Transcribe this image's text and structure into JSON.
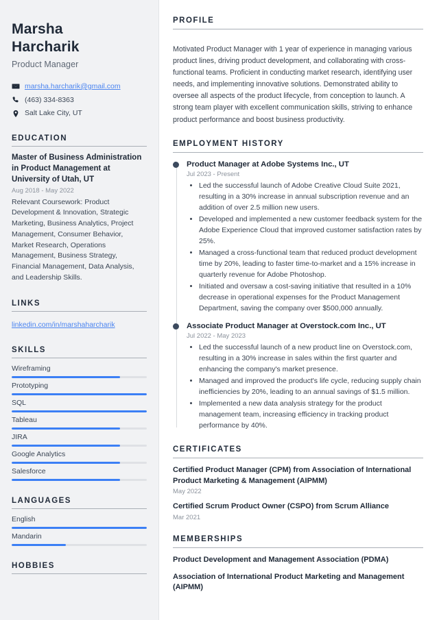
{
  "colors": {
    "accent": "#3b7ff5",
    "link": "#4a84f0",
    "heading": "#212b3a",
    "sidebar_bg": "#f1f2f4",
    "timeline_dot": "#3c4a5e"
  },
  "header": {
    "first_name": "Marsha",
    "last_name": "Harcharik",
    "job_title": "Product Manager",
    "contacts": [
      {
        "icon": "envelope-icon",
        "text": "marsha.harcharik@gmail.com",
        "is_link": true
      },
      {
        "icon": "phone-icon",
        "text": "(463) 334-8363",
        "is_link": false
      },
      {
        "icon": "location-pin-icon",
        "text": "Salt Lake City, UT",
        "is_link": false
      }
    ]
  },
  "sidebar": {
    "education": {
      "heading": "EDUCATION",
      "items": [
        {
          "title": "Master of Business Administration in Product Management at University of Utah, UT",
          "date": "Aug 2018 - May 2022",
          "description": "Relevant Coursework: Product Development & Innovation, Strategic Marketing, Business Analytics, Project Management, Consumer Behavior, Market Research, Operations Management, Business Strategy, Financial Management, Data Analysis, and Leadership Skills."
        }
      ]
    },
    "links": {
      "heading": "LINKS",
      "items": [
        {
          "label": "linkedin.com/in/marshaharcharik"
        }
      ]
    },
    "skills": {
      "heading": "SKILLS",
      "items": [
        {
          "label": "Wireframing",
          "level": 80
        },
        {
          "label": "Prototyping",
          "level": 100
        },
        {
          "label": "SQL",
          "level": 100
        },
        {
          "label": "Tableau",
          "level": 80
        },
        {
          "label": "JIRA",
          "level": 80
        },
        {
          "label": "Google Analytics",
          "level": 80
        },
        {
          "label": "Salesforce",
          "level": 80
        }
      ]
    },
    "languages": {
      "heading": "LANGUAGES",
      "items": [
        {
          "label": "English",
          "level": 100
        },
        {
          "label": "Mandarin",
          "level": 40
        }
      ]
    },
    "hobbies": {
      "heading": "HOBBIES"
    }
  },
  "main": {
    "profile": {
      "heading": "PROFILE",
      "text": "Motivated Product Manager with 1 year of experience in managing various product lines, driving product development, and collaborating with cross-functional teams. Proficient in conducting market research, identifying user needs, and implementing innovative solutions. Demonstrated ability to oversee all aspects of the product lifecycle, from conception to launch. A strong team player with excellent communication skills, striving to enhance product performance and boost business productivity."
    },
    "employment": {
      "heading": "EMPLOYMENT HISTORY",
      "jobs": [
        {
          "title": "Product Manager at Adobe Systems Inc., UT",
          "date": "Jul 2023 - Present",
          "bullets": [
            "Led the successful launch of Adobe Creative Cloud Suite 2021, resulting in a 30% increase in annual subscription revenue and an addition of over 2.5 million new users.",
            "Developed and implemented a new customer feedback system for the Adobe Experience Cloud that improved customer satisfaction rates by 25%.",
            "Managed a cross-functional team that reduced product development time by 20%, leading to faster time-to-market and a 15% increase in quarterly revenue for Adobe Photoshop.",
            "Initiated and oversaw a cost-saving initiative that resulted in a 10% decrease in operational expenses for the Product Management Department, saving the company over $500,000 annually."
          ]
        },
        {
          "title": "Associate Product Manager at Overstock.com Inc., UT",
          "date": "Jul 2022 - May 2023",
          "bullets": [
            "Led the successful launch of a new product line on Overstock.com, resulting in a 30% increase in sales within the first quarter and enhancing the company's market presence.",
            "Managed and improved the product's life cycle, reducing supply chain inefficiencies by 20%, leading to an annual savings of $1.5 million.",
            "Implemented a new data analysis strategy for the product management team, increasing efficiency in tracking product performance by 40%."
          ]
        }
      ]
    },
    "certificates": {
      "heading": "CERTIFICATES",
      "items": [
        {
          "title": "Certified Product Manager (CPM) from Association of International Product Marketing & Management (AIPMM)",
          "date": "May 2022"
        },
        {
          "title": "Certified Scrum Product Owner (CSPO) from Scrum Alliance",
          "date": "Mar 2021"
        }
      ]
    },
    "memberships": {
      "heading": "MEMBERSHIPS",
      "items": [
        {
          "title": "Product Development and Management Association (PDMA)"
        },
        {
          "title": "Association of International Product Marketing and Management (AIPMM)"
        }
      ]
    }
  }
}
